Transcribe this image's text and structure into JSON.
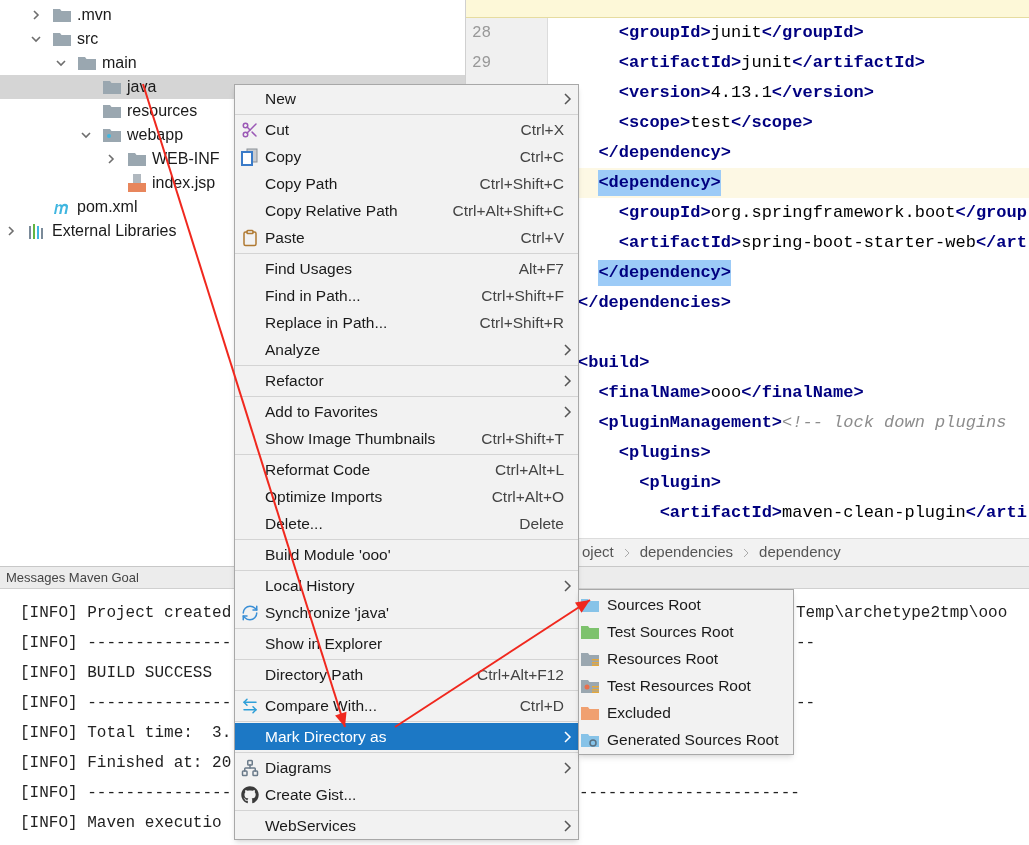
{
  "project_tree": {
    "items": [
      {
        "label": ".mvn",
        "kind": "folder",
        "expanded": false,
        "selected": false
      },
      {
        "label": "src",
        "kind": "folder",
        "expanded": true,
        "selected": false,
        "children": [
          {
            "label": "main",
            "kind": "folder",
            "expanded": true,
            "selected": false,
            "children": [
              {
                "label": "java",
                "kind": "folder",
                "selected": true
              },
              {
                "label": "resources",
                "kind": "folder",
                "selected": false
              },
              {
                "label": "webapp",
                "kind": "web_folder",
                "expanded": true,
                "selected": false,
                "children": [
                  {
                    "label": "WEB-INF",
                    "kind": "folder",
                    "expanded": false,
                    "selected": false
                  },
                  {
                    "label": "index.jsp",
                    "kind": "jsp",
                    "selected": false
                  }
                ]
              }
            ]
          }
        ]
      },
      {
        "label": "pom.xml",
        "kind": "maven",
        "selected": false
      }
    ],
    "libraries": {
      "label": "External Libraries",
      "expanded": false
    }
  },
  "editor": {
    "line_numbers": [
      "28",
      "29"
    ],
    "lines": [
      {
        "caret": false,
        "segments": [
          {
            "kind": "tag",
            "text": "    <groupId>"
          },
          {
            "kind": "text",
            "text": "junit"
          },
          {
            "kind": "tag",
            "text": "</groupId>"
          }
        ]
      },
      {
        "caret": false,
        "segments": [
          {
            "kind": "tag",
            "text": "    <artifactId>"
          },
          {
            "kind": "text",
            "text": "junit"
          },
          {
            "kind": "tag",
            "text": "</artifactId>"
          }
        ]
      },
      {
        "caret": false,
        "segments": [
          {
            "kind": "tag",
            "text": "    <version>"
          },
          {
            "kind": "text",
            "text": "4.13.1"
          },
          {
            "kind": "tag",
            "text": "</version>"
          }
        ]
      },
      {
        "caret": false,
        "segments": [
          {
            "kind": "tag",
            "text": "    <scope>"
          },
          {
            "kind": "text",
            "text": "test"
          },
          {
            "kind": "tag",
            "text": "</scope>"
          }
        ]
      },
      {
        "caret": false,
        "segments": [
          {
            "kind": "tag",
            "text": "  </dependency>"
          }
        ]
      },
      {
        "caret": true,
        "match": true,
        "segments": [
          {
            "kind": "tag",
            "text": "  <dependency>"
          }
        ]
      },
      {
        "caret": false,
        "segments": [
          {
            "kind": "tag",
            "text": "    <groupId>"
          },
          {
            "kind": "text",
            "text": "org.springframework.boot"
          },
          {
            "kind": "tag",
            "text": "</group"
          }
        ]
      },
      {
        "caret": false,
        "segments": [
          {
            "kind": "tag",
            "text": "    <artifactId>"
          },
          {
            "kind": "text",
            "text": "spring-boot-starter-web"
          },
          {
            "kind": "tag",
            "text": "</art"
          }
        ]
      },
      {
        "caret": false,
        "match": true,
        "segments": [
          {
            "kind": "tag",
            "text": "  </dependency>"
          }
        ]
      },
      {
        "caret": false,
        "segments": [
          {
            "kind": "tag",
            "text": "</dependencies>"
          }
        ]
      },
      {
        "caret": false,
        "gap_before": true,
        "segments": [
          {
            "kind": "tag",
            "text": "<build>"
          }
        ]
      },
      {
        "caret": false,
        "segments": [
          {
            "kind": "tag",
            "text": "  <finalName>"
          },
          {
            "kind": "text",
            "text": "ooo"
          },
          {
            "kind": "tag",
            "text": "</finalName>"
          }
        ]
      },
      {
        "caret": false,
        "segments": [
          {
            "kind": "tag",
            "text": "  <pluginManagement>"
          },
          {
            "kind": "comment",
            "text": "<!-- lock down plugins"
          }
        ]
      },
      {
        "caret": false,
        "segments": [
          {
            "kind": "tag",
            "text": "    <plugins>"
          }
        ]
      },
      {
        "caret": false,
        "segments": [
          {
            "kind": "tag",
            "text": "      <plugin>"
          }
        ]
      },
      {
        "caret": false,
        "segments": [
          {
            "kind": "tag",
            "text": "        <artifactId>"
          },
          {
            "kind": "text",
            "text": "maven-clean-plugin"
          },
          {
            "kind": "tag",
            "text": "</arti"
          }
        ]
      }
    ],
    "breadcrumbs": [
      "oject",
      "dependencies",
      "dependency"
    ]
  },
  "messages_panel": {
    "title": "Messages Maven Goal",
    "lines": [
      {
        "left": "[INFO] Project created",
        "right": "Temp\\archetype2tmp\\ooo",
        "kind": "gap_submenu"
      },
      {
        "left": "[INFO] ---------------",
        "right": "--",
        "kind": "gap_submenu"
      },
      {
        "left": "[INFO] BUILD SUCCESS"
      },
      {
        "left": "[INFO] ---------------",
        "right": "--",
        "kind": "gap_submenu"
      },
      {
        "left": "[INFO] Total time:  3."
      },
      {
        "left": "[INFO] Finished at: 20"
      },
      {
        "left": "[INFO] ---------------",
        "right": "-----------------------",
        "kind": "gap_menu"
      },
      {
        "left": "[INFO] Maven executio"
      }
    ]
  },
  "context_menu": {
    "groups": [
      [
        {
          "label": "New",
          "submenu": true,
          "selected": false
        }
      ],
      [
        {
          "label": "Cut",
          "shortcut": "Ctrl+X",
          "kind": "cut",
          "selected": false
        },
        {
          "label": "Copy",
          "shortcut": "Ctrl+C",
          "kind": "copy",
          "selected": false
        },
        {
          "label": "Copy Path",
          "shortcut": "Ctrl+Shift+C",
          "selected": false
        },
        {
          "label": "Copy Relative Path",
          "shortcut": "Ctrl+Alt+Shift+C",
          "selected": false
        },
        {
          "label": "Paste",
          "shortcut": "Ctrl+V",
          "kind": "paste",
          "selected": false
        }
      ],
      [
        {
          "label": "Find Usages",
          "shortcut": "Alt+F7",
          "selected": false
        },
        {
          "label": "Find in Path...",
          "shortcut": "Ctrl+Shift+F",
          "selected": false
        },
        {
          "label": "Replace in Path...",
          "shortcut": "Ctrl+Shift+R",
          "selected": false
        },
        {
          "label": "Analyze",
          "submenu": true,
          "selected": false
        }
      ],
      [
        {
          "label": "Refactor",
          "submenu": true,
          "selected": false
        }
      ],
      [
        {
          "label": "Add to Favorites",
          "submenu": true,
          "selected": false
        },
        {
          "label": "Show Image Thumbnails",
          "shortcut": "Ctrl+Shift+T",
          "selected": false
        }
      ],
      [
        {
          "label": "Reformat Code",
          "shortcut": "Ctrl+Alt+L",
          "selected": false
        },
        {
          "label": "Optimize Imports",
          "shortcut": "Ctrl+Alt+O",
          "selected": false
        },
        {
          "label": "Delete...",
          "shortcut": "Delete",
          "selected": false
        }
      ],
      [
        {
          "label": "Build Module 'ooo'",
          "selected": false
        }
      ],
      [
        {
          "label": "Local History",
          "submenu": true,
          "selected": false
        },
        {
          "label": "Synchronize 'java'",
          "kind": "sync",
          "selected": false
        }
      ],
      [
        {
          "label": "Show in Explorer",
          "selected": false
        }
      ],
      [
        {
          "label": "Directory Path",
          "shortcut": "Ctrl+Alt+F12",
          "selected": false
        }
      ],
      [
        {
          "label": "Compare With...",
          "shortcut": "Ctrl+D",
          "kind": "compare",
          "selected": false
        }
      ],
      [
        {
          "label": "Mark Directory as",
          "submenu": true,
          "selected": true
        }
      ],
      [
        {
          "label": "Diagrams",
          "submenu": true,
          "kind": "diagram",
          "selected": false
        },
        {
          "label": "Create Gist...",
          "kind": "gist",
          "selected": false
        }
      ],
      [
        {
          "label": "WebServices",
          "submenu": true,
          "selected": false
        }
      ]
    ]
  },
  "submenu": {
    "items": [
      {
        "label": "Sources Root",
        "kind": "sources",
        "selected": false
      },
      {
        "label": "Test Sources Root",
        "kind": "test_sources",
        "selected": false
      },
      {
        "label": "Resources Root",
        "kind": "resources",
        "selected": false
      },
      {
        "label": "Test Resources Root",
        "kind": "test_resources",
        "selected": false
      },
      {
        "label": "Excluded",
        "kind": "excluded",
        "selected": false
      },
      {
        "label": "Generated Sources Root",
        "kind": "generated",
        "selected": false
      }
    ]
  }
}
